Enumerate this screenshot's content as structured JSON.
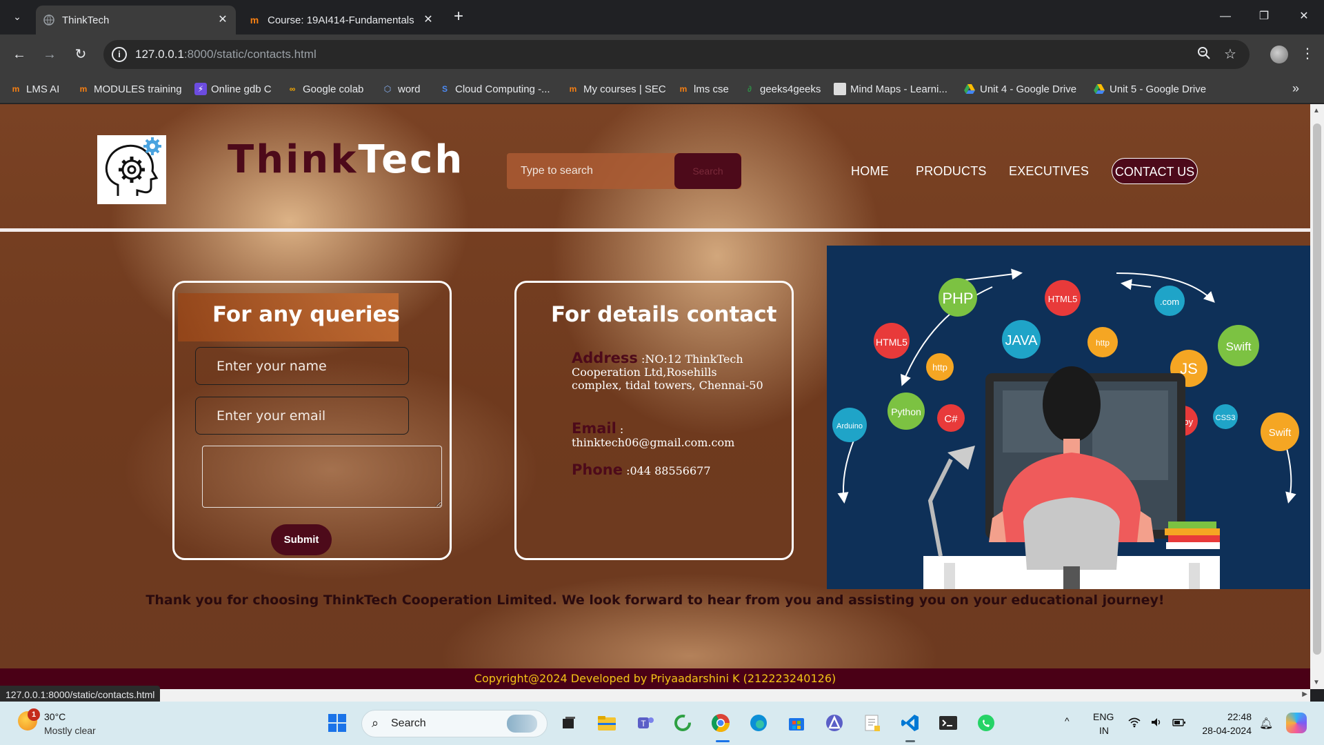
{
  "browser": {
    "tabs": [
      {
        "title": "ThinkTech",
        "active": true,
        "icon": "globe-icon"
      },
      {
        "title": "Course: 19AI414-Fundamentals",
        "active": false,
        "icon": "moodle-icon"
      }
    ],
    "url_host": "127.0.0.1",
    "url_path": ":8000/static/contacts.html",
    "bookmarks": [
      {
        "label": "LMS AI",
        "icon": "moodle-icon"
      },
      {
        "label": "MODULES training",
        "icon": "moodle-icon"
      },
      {
        "label": "Online gdb C",
        "icon": "bolt-icon"
      },
      {
        "label": "Google colab",
        "icon": "colab-icon"
      },
      {
        "label": "word",
        "icon": "word-icon"
      },
      {
        "label": "Cloud Computing -...",
        "icon": "cloud-icon"
      },
      {
        "label": "My courses | SEC",
        "icon": "moodle-icon"
      },
      {
        "label": "lms cse",
        "icon": "moodle-icon"
      },
      {
        "label": "geeks4geeks",
        "icon": "gfg-icon"
      },
      {
        "label": "Mind Maps - Learni...",
        "icon": "mindmap-icon"
      },
      {
        "label": "Unit 4 - Google Drive",
        "icon": "drive-icon"
      },
      {
        "label": "Unit 5 - Google Drive",
        "icon": "drive-icon"
      }
    ],
    "status_url": "127.0.0.1:8000/static/contacts.html"
  },
  "page": {
    "brand_think": "Think",
    "brand_tech": "Tech",
    "search": {
      "placeholder": "Type to search",
      "button": "Search"
    },
    "nav": {
      "home": "HOME",
      "products": "PRODUCTS",
      "executives": "EXECUTIVES",
      "contact": "CONTACT US"
    },
    "query_card": {
      "title": "For any queries",
      "name_placeholder": "Enter your name",
      "email_placeholder": "Enter your email",
      "submit": "Submit"
    },
    "details_card": {
      "title": "For details contact",
      "address_label": "Address",
      "address_value": ":NO:12 ThinkTech Cooperation Ltd,Rosehills complex, tidal towers, Chennai-50",
      "email_label": "Email",
      "email_value": ": thinktech06@gmail.com.com",
      "phone_label": "Phone",
      "phone_value": ":044 88556677"
    },
    "illustration_words": [
      "PHP",
      "HTML5",
      "JAVA",
      "http",
      "Python",
      "C#",
      "Arduino",
      "JS",
      "Swift",
      "Ruby",
      "CSS3",
      ".com",
      "HTML5",
      "Swift",
      "http"
    ],
    "thanks": "Thank you for choosing ThinkTech Cooperation Limited. We look forward to hear from you and assisting you on your educational journey!",
    "footer": "Copyright@2024 Developed by Priyaadarshini K (212223240126)"
  },
  "taskbar": {
    "weather_temp": "30°C",
    "weather_desc": "Mostly clear",
    "weather_badge": "1",
    "search_label": "Search",
    "lang1": "ENG",
    "lang2": "IN",
    "time": "22:48",
    "date": "28-04-2024"
  },
  "colors": {
    "maroon": "#4d0a1a",
    "footer_bg": "#4a0016",
    "footer_text": "#f3c516"
  }
}
